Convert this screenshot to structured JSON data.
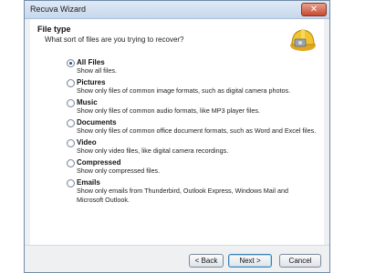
{
  "window": {
    "title": "Recuva Wizard",
    "close_glyph": "✕"
  },
  "header": {
    "title": "File type",
    "subtitle": "What sort of files are you trying to recover?",
    "logo_icon": "hard-hat-drive-icon"
  },
  "options": [
    {
      "label": "All Files",
      "desc": "Show all files.",
      "checked": true
    },
    {
      "label": "Pictures",
      "desc": "Show only files of common image formats, such as digital camera photos.",
      "checked": false
    },
    {
      "label": "Music",
      "desc": "Show only files of common audio formats, like MP3 player files.",
      "checked": false
    },
    {
      "label": "Documents",
      "desc": "Show only files of common office document formats, such as Word and Excel files.",
      "checked": false
    },
    {
      "label": "Video",
      "desc": "Show only video files, like digital camera recordings.",
      "checked": false
    },
    {
      "label": "Compressed",
      "desc": "Show only compressed files.",
      "checked": false
    },
    {
      "label": "Emails",
      "desc": "Show only emails from Thunderbird, Outlook Express, Windows Mail and Microsoft Outlook.",
      "checked": false
    }
  ],
  "buttons": {
    "back": "< Back",
    "next": "Next >",
    "cancel": "Cancel"
  },
  "colors": {
    "accent": "#3c7fb1",
    "close": "#c74b30",
    "logo_yellow": "#f2c530"
  }
}
